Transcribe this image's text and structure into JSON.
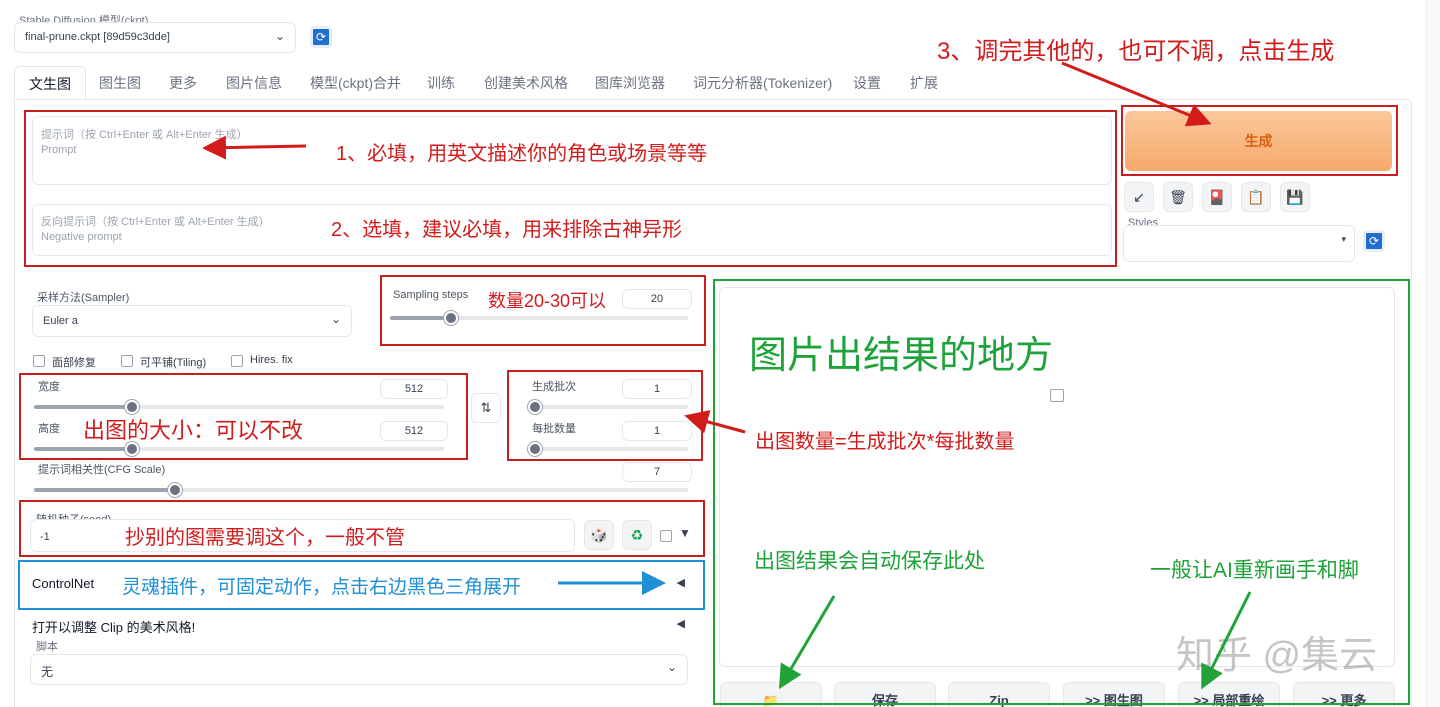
{
  "model": {
    "label": "Stable Diffusion 模型(ckpt)",
    "value": "final-prune.ckpt [89d59c3dde]"
  },
  "tabs": [
    "文生图",
    "图生图",
    "更多",
    "图片信息",
    "模型(ckpt)合并",
    "训练",
    "创建美术风格",
    "图库浏览器",
    "词元分析器(Tokenizer)",
    "设置",
    "扩展"
  ],
  "prompt": {
    "label": "提示词（按 Ctrl+Enter 或 Alt+Enter 生成）",
    "placeholder": "Prompt"
  },
  "negative": {
    "label": "反向提示词（按 Ctrl+Enter 或 Alt+Enter 生成）",
    "placeholder": "Negative prompt"
  },
  "generate_label": "生成",
  "styles_label": "Styles",
  "sampler": {
    "label": "采样方法(Sampler)",
    "value": "Euler a"
  },
  "steps": {
    "label": "Sampling steps",
    "value": "20",
    "level": 0.19
  },
  "checks": {
    "face": "面部修复",
    "tiling": "可平铺(Tiling)",
    "hires": "Hires. fix"
  },
  "width": {
    "label": "宽度",
    "value": "512",
    "level": 0.23
  },
  "height": {
    "label": "高度",
    "value": "512",
    "level": 0.23
  },
  "batch_count": {
    "label": "生成批次",
    "value": "1",
    "level": 0.0
  },
  "batch_size": {
    "label": "每批数量",
    "value": "1",
    "level": 0.0
  },
  "cfg": {
    "label": "提示词相关性(CFG Scale)",
    "value": "7",
    "level": 0.21
  },
  "seed": {
    "label": "随机种子(seed)",
    "value": "-1"
  },
  "controlnet_label": "ControlNet",
  "clip_label": "打开以调整 Clip 的美术风格!",
  "script": {
    "label": "脚本",
    "value": "无"
  },
  "output_buttons": [
    "保存",
    "Zip",
    ">> 图生图",
    ">> 局部重绘",
    ">> 更多"
  ],
  "annotations": {
    "a1": "1、必填，用英文描述你的角色或场景等等",
    "a2": "2、选填，建议必填，用来排除古神异形",
    "a3": "3、调完其他的，也可不调，点击生成",
    "steps_note": "数量20-30可以",
    "size_note": "出图的大小：可以不改",
    "batch_note": "出图数量=生成批次*每批数量",
    "seed_note": "抄别的图需要调这个，一般不管",
    "controlnet_note": "灵魂插件，可固定动作，点击右边黑色三角展开",
    "output_note": "图片出结果的地方",
    "save_note": "出图结果会自动保存此处",
    "inpaint_note": "一般让AI重新画手和脚",
    "watermark": "知乎 @集云"
  },
  "colors": {
    "red": "#c81e1e",
    "green": "#22a33a",
    "blue": "#1f8fd6",
    "generate": "#f8b882"
  }
}
